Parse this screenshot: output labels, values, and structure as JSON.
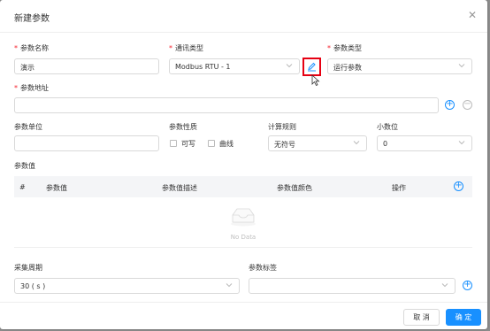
{
  "dialog": {
    "title": "新建参数"
  },
  "form": {
    "param_name": {
      "label": "参数名称",
      "value": "演示"
    },
    "comm_type": {
      "label": "通讯类型",
      "value": "Modbus RTU - 1"
    },
    "param_type": {
      "label": "参数类型",
      "value": "运行参数"
    },
    "param_addr": {
      "label": "参数地址",
      "value": ""
    },
    "param_unit": {
      "label": "参数单位",
      "value": ""
    },
    "param_nature": {
      "label": "参数性质",
      "options": [
        "可写",
        "曲线"
      ]
    },
    "calc_rule": {
      "label": "计算规则",
      "value": "无符号"
    },
    "decimal": {
      "label": "小数位",
      "value": "0"
    },
    "param_values": {
      "label": "参数值",
      "columns": [
        "#",
        "参数值",
        "参数值描述",
        "参数值颜色",
        "操作"
      ],
      "empty_text": "No Data"
    },
    "period": {
      "label": "采集周期",
      "value": "30 ( s )"
    },
    "tags": {
      "label": "参数标签",
      "value": ""
    }
  },
  "footer": {
    "cancel_label": "取 消",
    "ok_label": "确 定"
  },
  "colors": {
    "accent": "#1890ff",
    "required": "#f5222d",
    "highlight": "#e60012"
  },
  "icons": [
    "close-icon",
    "edit-icon",
    "plus-circle-icon",
    "minus-circle-icon",
    "chevron-down-icon",
    "empty-box-icon",
    "cursor-icon"
  ]
}
